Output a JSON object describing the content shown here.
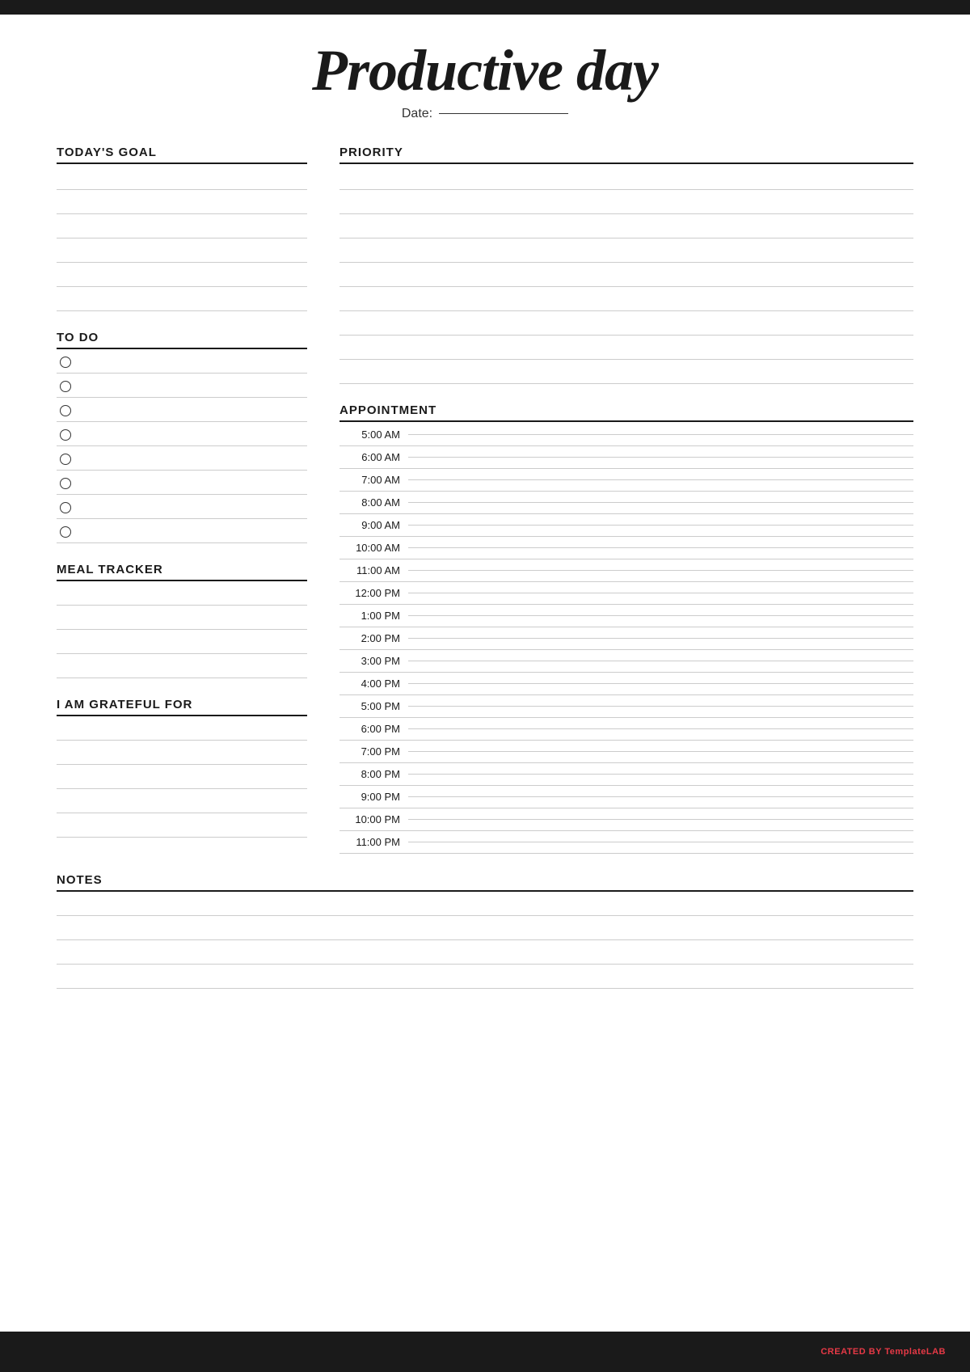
{
  "header": {
    "title": "Productive day",
    "date_label": "Date:",
    "brand_created": "CREATED BY",
    "brand_name": "Template",
    "brand_highlight": "LAB"
  },
  "left": {
    "todays_goal": {
      "label": "TODAY'S GOAL",
      "lines": 6
    },
    "todo": {
      "label": "TO DO",
      "items": 8
    },
    "meal_tracker": {
      "label": "MEAL TRACKER",
      "lines": 4
    },
    "grateful": {
      "label": "I AM GRATEFUL FOR",
      "lines": 5
    }
  },
  "right": {
    "priority": {
      "label": "PRIORITY",
      "lines": 9
    },
    "appointment": {
      "label": "APPOINTMENT",
      "times": [
        "5:00 AM",
        "6:00 AM",
        "7:00 AM",
        "8:00 AM",
        "9:00 AM",
        "10:00 AM",
        "11:00 AM",
        "12:00 PM",
        "1:00 PM",
        "2:00 PM",
        "3:00 PM",
        "4:00 PM",
        "5:00 PM",
        "6:00 PM",
        "7:00 PM",
        "8:00 PM",
        "9:00 PM",
        "10:00 PM",
        "11:00 PM"
      ]
    }
  },
  "notes": {
    "label": "NOTES",
    "lines": 4
  }
}
